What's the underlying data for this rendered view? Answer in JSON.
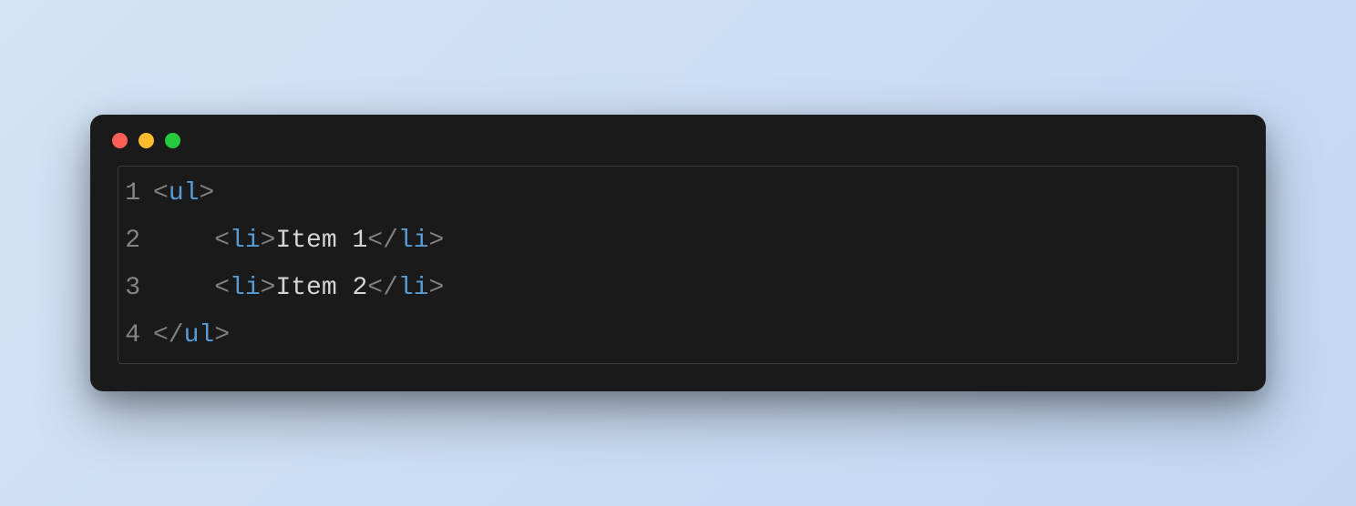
{
  "code": {
    "lines": [
      {
        "num": "1",
        "tokens": [
          {
            "cls": "bracket",
            "t": "<"
          },
          {
            "cls": "tag",
            "t": "ul"
          },
          {
            "cls": "bracket",
            "t": ">"
          }
        ]
      },
      {
        "num": "2",
        "tokens": [
          {
            "cls": "text",
            "t": "    "
          },
          {
            "cls": "bracket",
            "t": "<"
          },
          {
            "cls": "tag",
            "t": "li"
          },
          {
            "cls": "bracket",
            "t": ">"
          },
          {
            "cls": "text",
            "t": "Item 1"
          },
          {
            "cls": "bracket",
            "t": "</"
          },
          {
            "cls": "tag",
            "t": "li"
          },
          {
            "cls": "bracket",
            "t": ">"
          }
        ]
      },
      {
        "num": "3",
        "tokens": [
          {
            "cls": "text",
            "t": "    "
          },
          {
            "cls": "bracket",
            "t": "<"
          },
          {
            "cls": "tag",
            "t": "li"
          },
          {
            "cls": "bracket",
            "t": ">"
          },
          {
            "cls": "text",
            "t": "Item 2"
          },
          {
            "cls": "bracket",
            "t": "</"
          },
          {
            "cls": "tag",
            "t": "li"
          },
          {
            "cls": "bracket",
            "t": ">"
          }
        ]
      },
      {
        "num": "4",
        "tokens": [
          {
            "cls": "bracket",
            "t": "</"
          },
          {
            "cls": "tag",
            "t": "ul"
          },
          {
            "cls": "bracket",
            "t": ">"
          }
        ]
      }
    ]
  }
}
